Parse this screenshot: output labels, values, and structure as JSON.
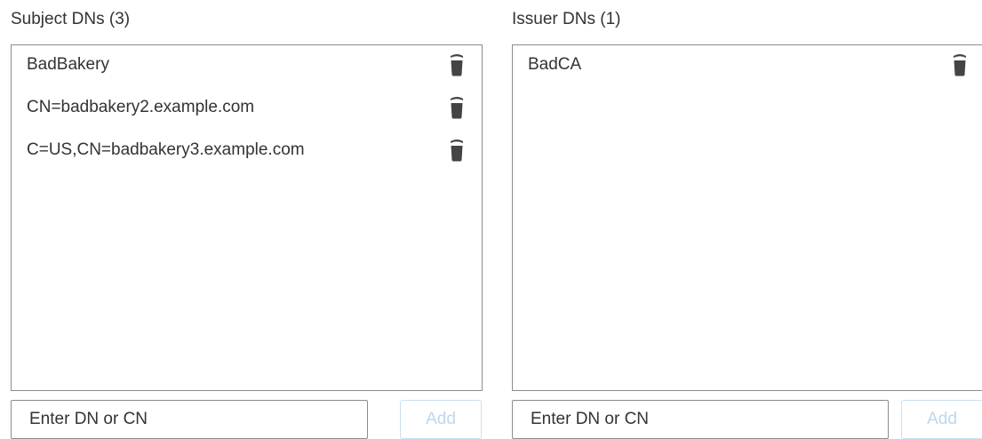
{
  "subject": {
    "title": "Subject DNs (3)",
    "items": [
      {
        "label": "BadBakery",
        "delete_icon": "trash-icon"
      },
      {
        "label": "CN=badbakery2.example.com",
        "delete_icon": "trash-icon"
      },
      {
        "label": "C=US,CN=badbakery3.example.com",
        "delete_icon": "trash-icon"
      }
    ],
    "input": {
      "placeholder": "Enter DN or CN",
      "value": ""
    },
    "add_label": "Add"
  },
  "issuer": {
    "title": "Issuer DNs (1)",
    "items": [
      {
        "label": "BadCA",
        "delete_icon": "trash-icon"
      }
    ],
    "input": {
      "placeholder": "Enter DN or CN",
      "value": ""
    },
    "add_label": "Add"
  },
  "colors": {
    "text": "#333333",
    "border": "#8c8c8c",
    "icon": "#444444",
    "add_button_text_disabled": "#bdd7ee",
    "add_button_border_disabled": "#c9e1f3"
  }
}
